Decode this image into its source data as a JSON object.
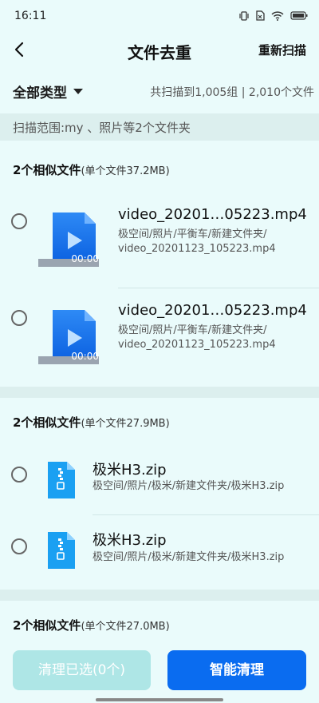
{
  "status": {
    "time": "16:11"
  },
  "header": {
    "title": "文件去重",
    "rescan_label": "重新扫描"
  },
  "filter": {
    "type_label": "全部类型",
    "summary": "共扫描到1,005组 | 2,010个文件"
  },
  "scope": {
    "text": "扫描范围:my 、照片等2个文件夹"
  },
  "groups": [
    {
      "title": "2个相似文件",
      "sub": "(单个文件37.2MB)",
      "files": [
        {
          "name": "video_20201…05223.mp4",
          "path_line1": "极空间/照片/平衡车/新建文件夹/",
          "path_line2": "video_20201123_105223.mp4",
          "duration": "00:00"
        },
        {
          "name": "video_20201…05223.mp4",
          "path_line1": "极空间/照片/平衡车/新建文件夹/",
          "path_line2": "video_20201123_105223.mp4",
          "duration": "00:00"
        }
      ]
    },
    {
      "title": "2个相似文件",
      "sub": "(单个文件27.9MB)",
      "files": [
        {
          "name": "极米H3.zip",
          "path": "极空间/照片/极米/新建文件夹/极米H3.zip"
        },
        {
          "name": "极米H3.zip",
          "path": "极空间/照片/极米/新建文件夹/极米H3.zip"
        }
      ]
    },
    {
      "title": "2个相似文件",
      "sub": "(单个文件27.0MB)"
    }
  ],
  "actions": {
    "clear_selected": "清理已选(0个)",
    "smart_clean": "智能清理"
  },
  "colors": {
    "accent": "#0a6cf0",
    "background": "#eafbfb",
    "disabled_button": "#aee6e6"
  },
  "icons": {
    "back": "chevron-left-icon",
    "dropdown": "caret-down-icon",
    "video": "video-file-icon",
    "zip": "zip-file-icon"
  }
}
